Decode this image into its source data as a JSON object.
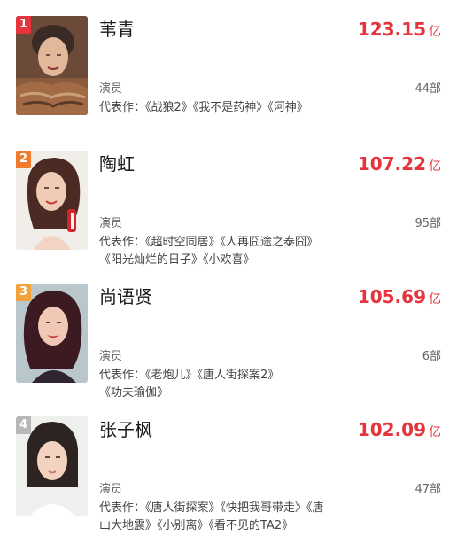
{
  "items": [
    {
      "rank": "1",
      "rank_color": "#e5343b",
      "name": "苇青",
      "box_value": "123.15",
      "box_unit": "亿",
      "role": "演员",
      "count": "44部",
      "works": "代表作：《战狼2》《我不是药神》《河神》"
    },
    {
      "rank": "2",
      "rank_color": "#f07b2e",
      "name": "陶虹",
      "box_value": "107.22",
      "box_unit": "亿",
      "role": "演员",
      "count": "95部",
      "works": "代表作：《超时空同居》《人再囧途之泰囧》\n《阳光灿烂的日子》《小欢喜》"
    },
    {
      "rank": "3",
      "rank_color": "#f4a23b",
      "name": "尚语贤",
      "box_value": "105.69",
      "box_unit": "亿",
      "role": "演员",
      "count": "6部",
      "works": "代表作：《老炮儿》《唐人街探案2》\n《功夫瑜伽》"
    },
    {
      "rank": "4",
      "rank_color": "#b7b7b7",
      "name": "张子枫",
      "box_value": "102.09",
      "box_unit": "亿",
      "role": "演员",
      "count": "47部",
      "works": "代表作：《唐人街探案》《快把我哥带走》《唐\n山大地震》《小别离》《看不见的TA2》"
    }
  ]
}
